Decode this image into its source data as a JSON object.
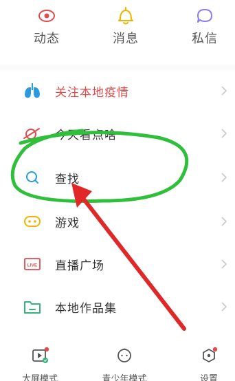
{
  "top_actions": [
    {
      "label": "动态",
      "icon": "eye-icon"
    },
    {
      "label": "消息",
      "icon": "bell-icon"
    },
    {
      "label": "私信",
      "icon": "chat-bubble-icon"
    }
  ],
  "menu": [
    {
      "label": "关注本地疫情",
      "icon": "lungs-icon",
      "highlight": true
    },
    {
      "label": "今天看点啥",
      "icon": "planet-icon"
    },
    {
      "label": "查找",
      "icon": "search-icon"
    },
    {
      "label": "游戏",
      "icon": "gamepad-icon"
    },
    {
      "label": "直播广场",
      "icon": "live-icon"
    },
    {
      "label": "本地作品集",
      "icon": "folder-icon"
    }
  ],
  "bottom_bar": [
    {
      "label": "大屏模式",
      "icon": "tv-play-icon"
    },
    {
      "label": "青少年模式",
      "icon": "teen-face-icon"
    },
    {
      "label": "设置",
      "icon": "gear-hex-icon"
    }
  ],
  "colors": {
    "accent_red": "#e14b4b",
    "icon_gray": "#8a8a8a",
    "icon_yellow": "#f0b400",
    "icon_purple": "#8a7ef0",
    "icon_blue": "#2a9be0",
    "icon_green": "#34b478",
    "annotation_green": "#2fbf3a",
    "annotation_arrow": "#e02828"
  }
}
